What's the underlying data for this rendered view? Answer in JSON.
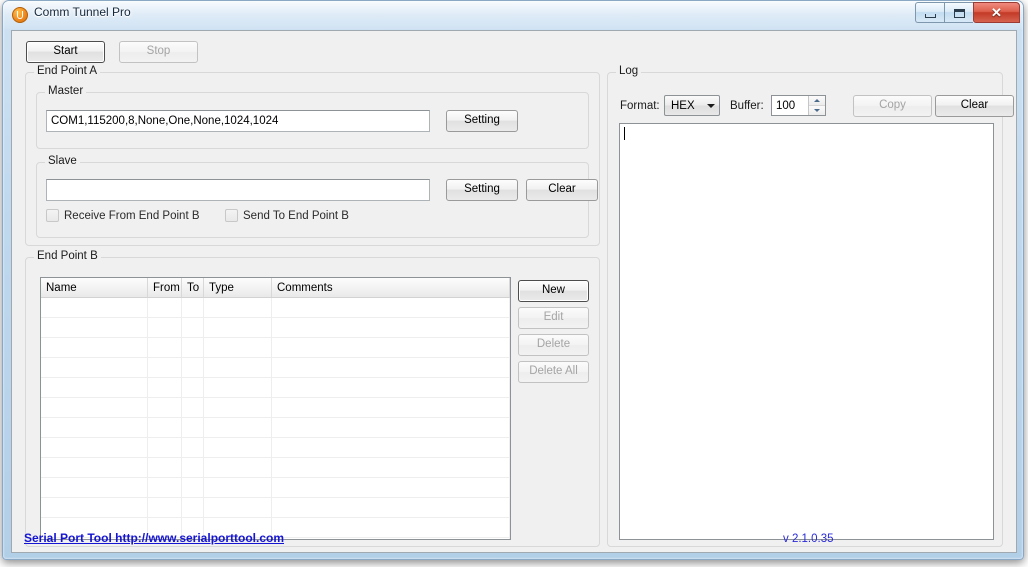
{
  "window": {
    "title": "Comm Tunnel Pro",
    "icon": "app-circle-icon",
    "minimize_label": "—",
    "maximize_label": "□",
    "close_label": "✕"
  },
  "toolbar": {
    "start_label": "Start",
    "stop_label": "Stop"
  },
  "end_point_a": {
    "legend": "End Point A",
    "master": {
      "legend": "Master",
      "value": "COM1,115200,8,None,One,None,1024,1024",
      "setting_label": "Setting"
    },
    "slave": {
      "legend": "Slave",
      "value": "",
      "setting_label": "Setting",
      "clear_label": "Clear",
      "receive_checkbox_label": "Receive From End Point B",
      "receive_checked": false,
      "send_checkbox_label": "Send  To End Point B",
      "send_checked": false
    }
  },
  "end_point_b": {
    "legend": "End Point B",
    "columns": [
      "Name",
      "From",
      "To",
      "Type",
      "Comments"
    ],
    "rows": [],
    "empty_row_count": 13,
    "buttons": {
      "new_label": "New",
      "edit_label": "Edit",
      "delete_label": "Delete",
      "delete_all_label": "Delete All"
    }
  },
  "log": {
    "legend": "Log",
    "format_label": "Format:",
    "format_value": "HEX",
    "format_options": [
      "HEX"
    ],
    "buffer_label": "Buffer:",
    "buffer_value": "100",
    "copy_label": "Copy",
    "clear_label": "Clear",
    "content": ""
  },
  "footer": {
    "link_text": "Serial Port Tool   http://www.serialporttool.com",
    "version": "v 2.1.0.35",
    "link_color": "#1414d2",
    "version_color": "#2a2ad8"
  }
}
